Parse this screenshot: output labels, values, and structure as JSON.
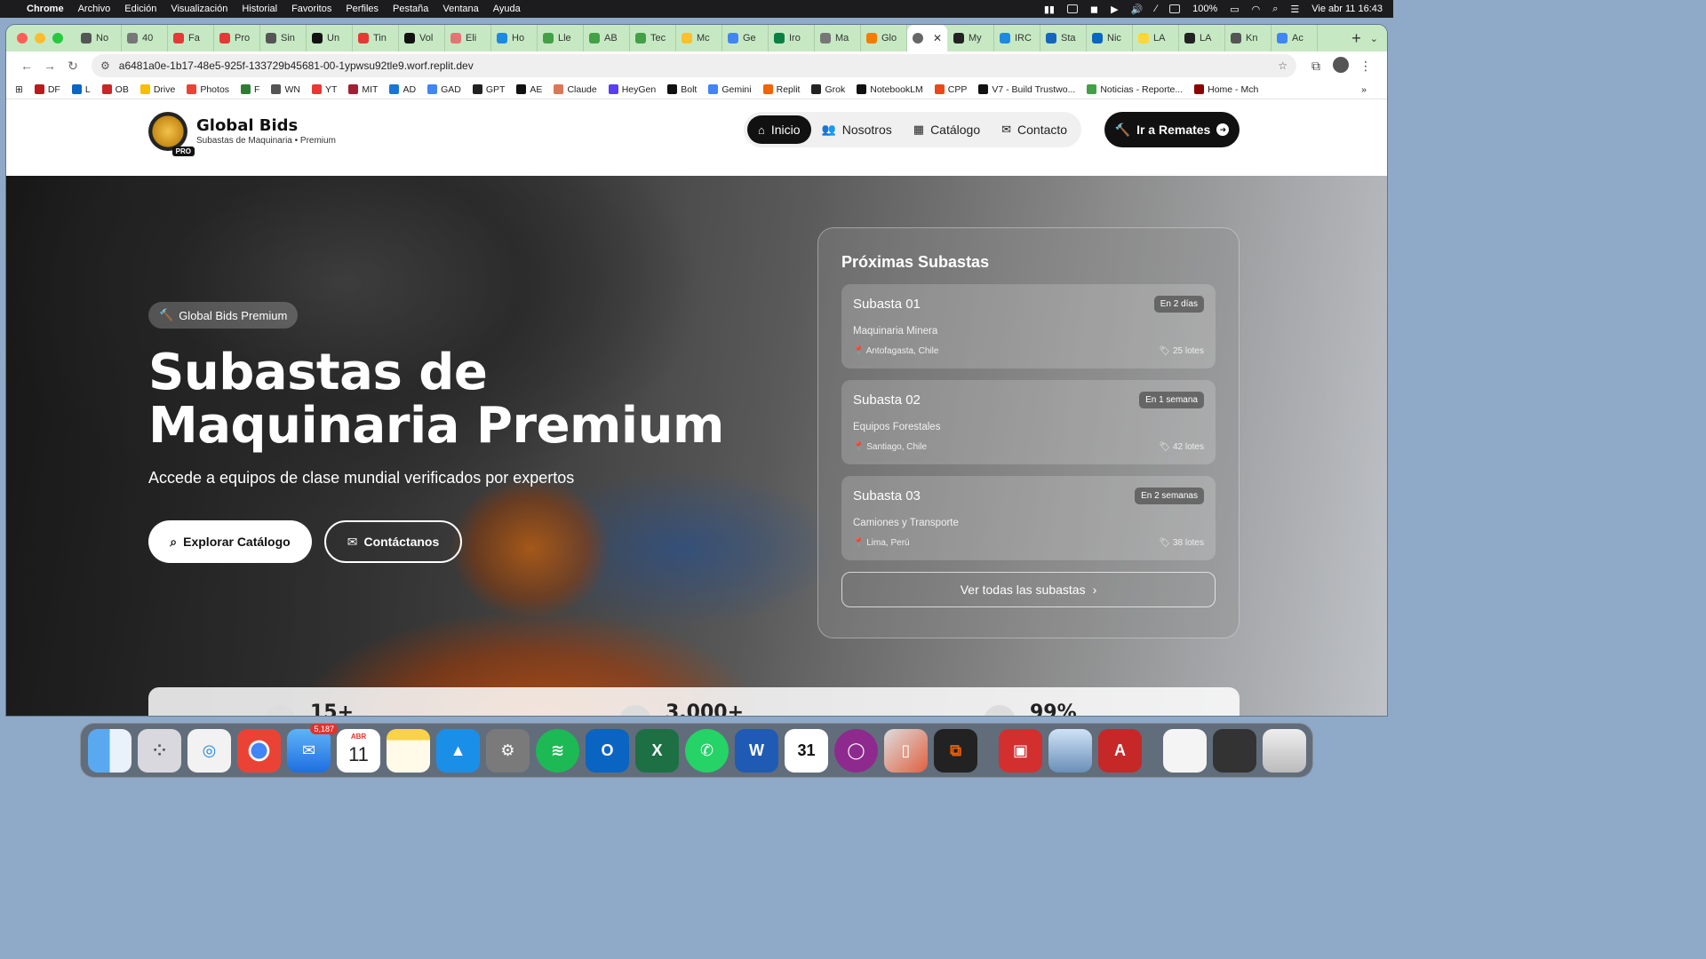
{
  "menubar": {
    "app": "Chrome",
    "items": [
      "Archivo",
      "Edición",
      "Visualización",
      "Historial",
      "Favoritos",
      "Perfiles",
      "Pestaña",
      "Ventana",
      "Ayuda"
    ],
    "battery": "100%",
    "datetime": "Vie abr 11  16:43"
  },
  "tabs": [
    {
      "label": "No",
      "color": "#555"
    },
    {
      "label": "40",
      "color": "#777"
    },
    {
      "label": "Fa",
      "color": "#e53935"
    },
    {
      "label": "Pro",
      "color": "#e53935"
    },
    {
      "label": "Sin",
      "color": "#555"
    },
    {
      "label": "Un",
      "color": "#111"
    },
    {
      "label": "Tin",
      "color": "#e53935"
    },
    {
      "label": "Vol",
      "color": "#111"
    },
    {
      "label": "Eli",
      "color": "#e57373"
    },
    {
      "label": "Ho",
      "color": "#1e88e5"
    },
    {
      "label": "Lle",
      "color": "#43a047"
    },
    {
      "label": "AB",
      "color": "#43a047"
    },
    {
      "label": "Tec",
      "color": "#43a047"
    },
    {
      "label": "Mc",
      "color": "#fbc02d"
    },
    {
      "label": "Ge",
      "color": "#4285f4"
    },
    {
      "label": "Iro",
      "color": "#0b8043"
    },
    {
      "label": "Ma",
      "color": "#777"
    },
    {
      "label": "Glo",
      "color": "#f57c00"
    }
  ],
  "tabs_right": [
    {
      "label": "My",
      "color": "#222"
    },
    {
      "label": "IRC",
      "color": "#1e88e5"
    },
    {
      "label": "Sta",
      "color": "#1565c0"
    },
    {
      "label": "Nic",
      "color": "#0a66c2"
    },
    {
      "label": "LA",
      "color": "#fdd835"
    },
    {
      "label": "LA",
      "color": "#222"
    },
    {
      "label": "Kn",
      "color": "#555"
    },
    {
      "label": "Ac",
      "color": "#4285f4"
    }
  ],
  "address": {
    "url": "a6481a0e-1b17-48e5-925f-133729b45681-00-1ypwsu92tle9.worf.replit.dev"
  },
  "bookmarks": [
    {
      "label": "DF",
      "color": "#b71c1c"
    },
    {
      "label": "L",
      "color": "#0a66c2"
    },
    {
      "label": "OB",
      "color": "#c62828"
    },
    {
      "label": "Drive",
      "color": "#fbbc04"
    },
    {
      "label": "Photos",
      "color": "#ea4335"
    },
    {
      "label": "F",
      "color": "#2e7d32"
    },
    {
      "label": "WN",
      "color": "#555"
    },
    {
      "label": "YT",
      "color": "#e53935"
    },
    {
      "label": "MIT",
      "color": "#a31f34"
    },
    {
      "label": "AD",
      "color": "#1976d2"
    },
    {
      "label": "GAD",
      "color": "#4285f4"
    },
    {
      "label": "GPT",
      "color": "#222"
    },
    {
      "label": "AE",
      "color": "#111"
    },
    {
      "label": "Claude",
      "color": "#d97757"
    },
    {
      "label": "HeyGen",
      "color": "#5b3df5"
    },
    {
      "label": "Bolt",
      "color": "#111"
    },
    {
      "label": "Gemini",
      "color": "#4285f4"
    },
    {
      "label": "Replit",
      "color": "#f26207"
    },
    {
      "label": "Grok",
      "color": "#222"
    },
    {
      "label": "NotebookLM",
      "color": "#111"
    },
    {
      "label": "CPP",
      "color": "#e64a19"
    },
    {
      "label": "V7 - Build Trustwo...",
      "color": "#111"
    },
    {
      "label": "Noticias - Reporte...",
      "color": "#43a047"
    },
    {
      "label": "Home - Mch",
      "color": "#8b0000"
    }
  ],
  "site": {
    "brand": "Global Bids",
    "tagline": "Subastas de Maquinaria • Premium",
    "logo_badge": "PRO",
    "nav": [
      {
        "label": "Inicio",
        "icon": "home-icon",
        "active": true
      },
      {
        "label": "Nosotros",
        "icon": "users-icon",
        "active": false
      },
      {
        "label": "Catálogo",
        "icon": "grid-icon",
        "active": false
      },
      {
        "label": "Contacto",
        "icon": "envelope-icon",
        "active": false
      }
    ],
    "cta": "Ir a Remates"
  },
  "hero": {
    "badge": "Global Bids Premium",
    "title_line1": "Subastas de",
    "title_line2": "Maquinaria Premium",
    "subtitle": "Accede a equipos de clase mundial verificados por expertos",
    "primary_btn": "Explorar Catálogo",
    "secondary_btn": "Contáctanos"
  },
  "auctions": {
    "title": "Próximas Subastas",
    "items": [
      {
        "name": "Subasta 01",
        "when": "En 2 días",
        "category": "Maquinaria Minera",
        "location": "Antofagasta, Chile",
        "lots": "25 lotes"
      },
      {
        "name": "Subasta 02",
        "when": "En 1 semana",
        "category": "Equipos Forestales",
        "location": "Santiago, Chile",
        "lots": "42 lotes"
      },
      {
        "name": "Subasta 03",
        "when": "En 2 semanas",
        "category": "Camiones y Transporte",
        "location": "Lima, Perú",
        "lots": "38 lotes"
      }
    ],
    "see_all": "Ver todas las subastas"
  },
  "stats": [
    "15+",
    "3.000+",
    "99%"
  ],
  "dock": {
    "mail_badge": "5,187",
    "calendar_month": "ABR",
    "calendar_day": "11"
  }
}
